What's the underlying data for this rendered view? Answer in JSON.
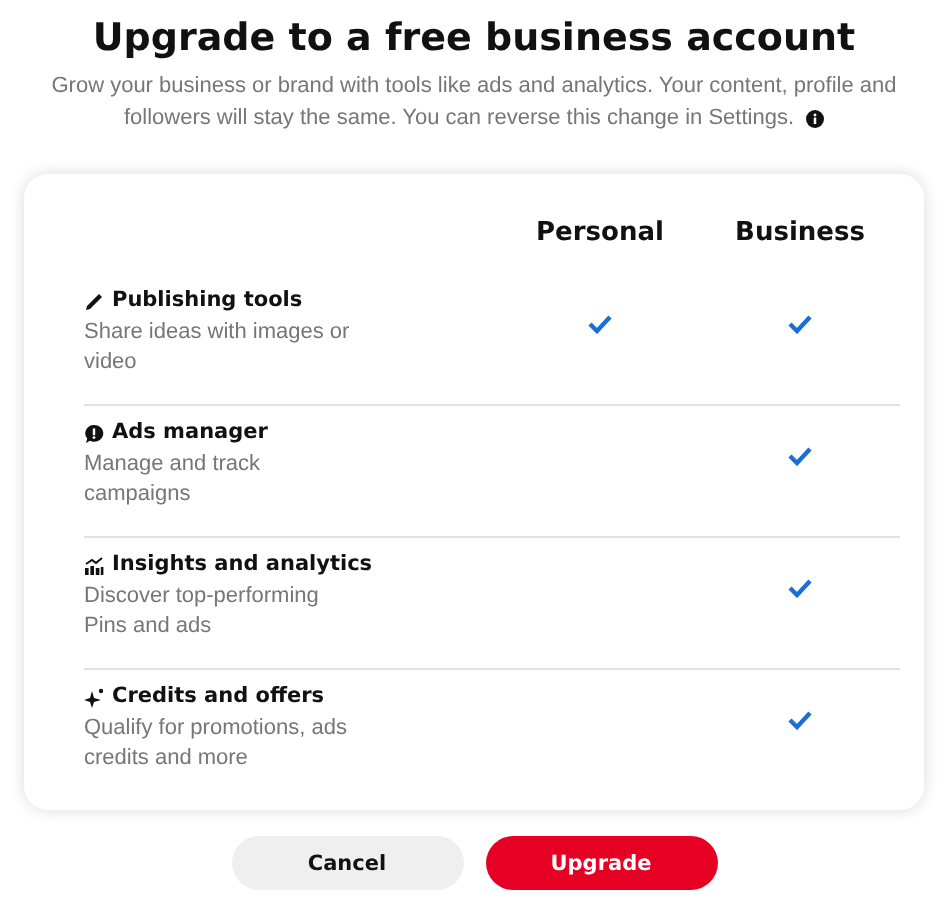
{
  "title": "Upgrade to a free business account",
  "subtitle": [
    "Grow your business or brand with tools like ads and analytics. Your content, profile and",
    "followers will stay the same. You can reverse this change in Settings."
  ],
  "columns": [
    "Personal",
    "Business"
  ],
  "features": [
    {
      "title": "Publishing tools",
      "description": "Share ideas with images or video",
      "personal": true,
      "business": true
    },
    {
      "title": "Ads manager",
      "description": "Manage and track campaigns",
      "personal": false,
      "business": true
    },
    {
      "title": "Insights and analytics",
      "description": "Discover top-performing Pins and ads",
      "personal": false,
      "business": true
    },
    {
      "title": "Credits and offers",
      "description": "Qualify for promotions, ads credits and more",
      "personal": false,
      "business": true
    }
  ],
  "buttons": {
    "cancel": "Cancel",
    "upgrade": "Upgrade"
  }
}
